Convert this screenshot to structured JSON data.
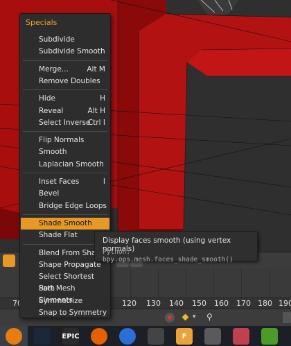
{
  "menu": {
    "title": "Specials",
    "groups": [
      [
        {
          "label": "Subdivide",
          "shortcut": ""
        },
        {
          "label": "Subdivide Smooth",
          "shortcut": ""
        }
      ],
      [
        {
          "label": "Merge...",
          "shortcut": "Alt M"
        },
        {
          "label": "Remove Doubles",
          "shortcut": ""
        }
      ],
      [
        {
          "label": "Hide",
          "shortcut": "H"
        },
        {
          "label": "Reveal",
          "shortcut": "Alt H"
        },
        {
          "label": "Select Inverse",
          "shortcut": "Ctrl I"
        }
      ],
      [
        {
          "label": "Flip Normals",
          "shortcut": ""
        },
        {
          "label": "Smooth",
          "shortcut": ""
        },
        {
          "label": "Laplacian Smooth",
          "shortcut": ""
        }
      ],
      [
        {
          "label": "Inset Faces",
          "shortcut": "I"
        },
        {
          "label": "Bevel",
          "shortcut": ""
        },
        {
          "label": "Bridge Edge Loops",
          "shortcut": ""
        }
      ],
      [
        {
          "label": "Shade Smooth",
          "shortcut": "",
          "highlighted": true
        },
        {
          "label": "Shade Flat",
          "shortcut": ""
        }
      ],
      [
        {
          "label": "Blend From Shape",
          "shortcut": ""
        },
        {
          "label": "Shape Propagate",
          "shortcut": ""
        },
        {
          "label": "Select Shortest Path",
          "shortcut": ""
        },
        {
          "label": "Sort Mesh Elements",
          "shortcut": ""
        },
        {
          "label": "Symmetrize",
          "shortcut": ""
        },
        {
          "label": "Snap to Symmetry",
          "shortcut": ""
        }
      ]
    ]
  },
  "tooltip": {
    "description": "Display faces smooth (using vertex normals)",
    "python": "Python: bpy.ops.mesh.faces_shade_smooth()"
  },
  "timeline": {
    "ticks": [
      "70",
      "120",
      "130",
      "140",
      "150",
      "160",
      "170",
      "180",
      "190"
    ]
  },
  "taskbar": {
    "apps": [
      {
        "name": "blender-icon",
        "label": "",
        "color": "#e87d0d"
      },
      {
        "name": "steam-icon",
        "label": "",
        "color": "#1b2838"
      },
      {
        "name": "epic-games-icon",
        "label": "EPIC",
        "color": "#2a2a2a"
      },
      {
        "name": "firefox-icon",
        "label": "",
        "color": "#e66000"
      },
      {
        "name": "speaker-icon",
        "label": "",
        "color": "#2a6fd6"
      },
      {
        "name": "zbrush-icon",
        "label": "",
        "color": "#444"
      },
      {
        "name": "files-icon",
        "label": "F",
        "color": "#e8a33a"
      },
      {
        "name": "headphones-icon",
        "label": "",
        "color": "#5a5a5a"
      },
      {
        "name": "game-icon",
        "label": "",
        "color": "#c04050"
      },
      {
        "name": "torrent-icon",
        "label": "",
        "color": "#4c9a2a"
      }
    ]
  },
  "colors": {
    "accent": "#e69a25",
    "mesh_red": "#b01010"
  }
}
